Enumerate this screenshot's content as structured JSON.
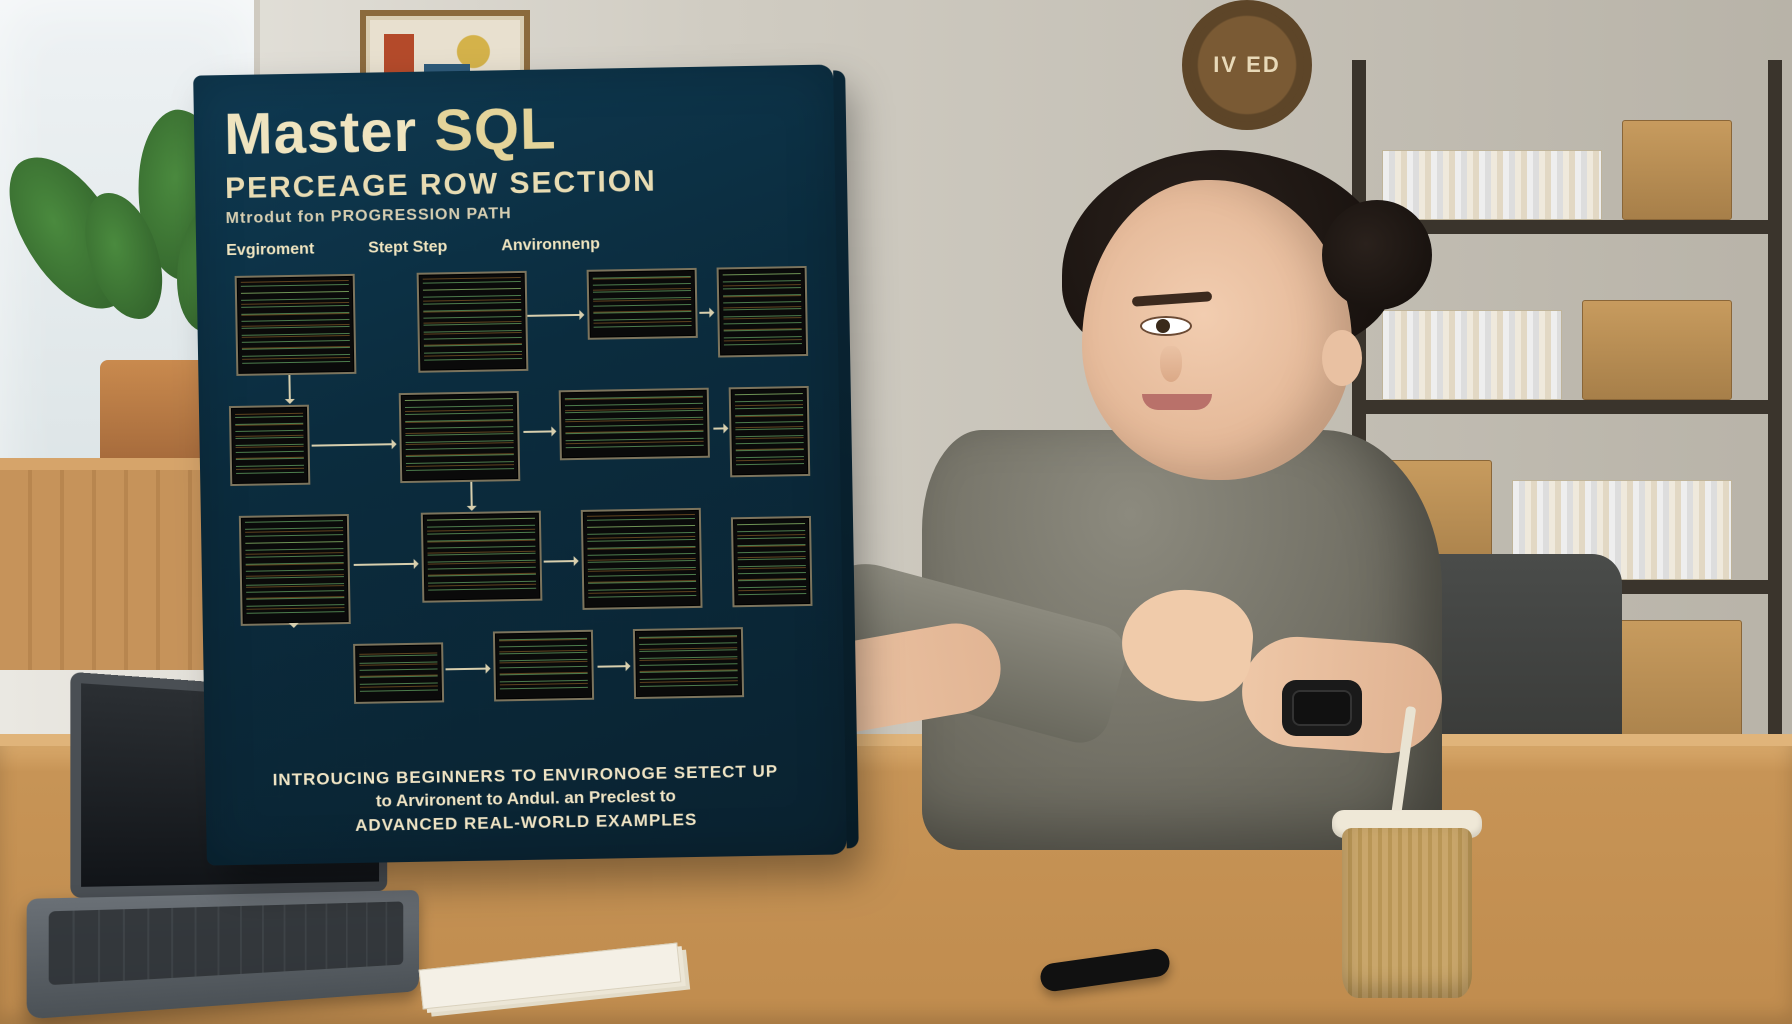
{
  "clock_text": "IV  ED",
  "book": {
    "title_a": "Master",
    "title_b": "SQL",
    "subtitle": "PERCEAGE ROW SECTION",
    "tagline": "Mtrodut fon PROGRESSION PATH",
    "labels": {
      "l1": "Evgiroment",
      "l2": "Stept Step",
      "l3": "Anvironnenp"
    },
    "blurb_line1": "INTROUCING BEGINNERS TO ENVIRONOGE SETECT UP",
    "blurb_line2": "to Arvironent to Andul. an Preclest to",
    "blurb_line3": "ADVANCED REAL-WORLD EXAMPLES"
  }
}
